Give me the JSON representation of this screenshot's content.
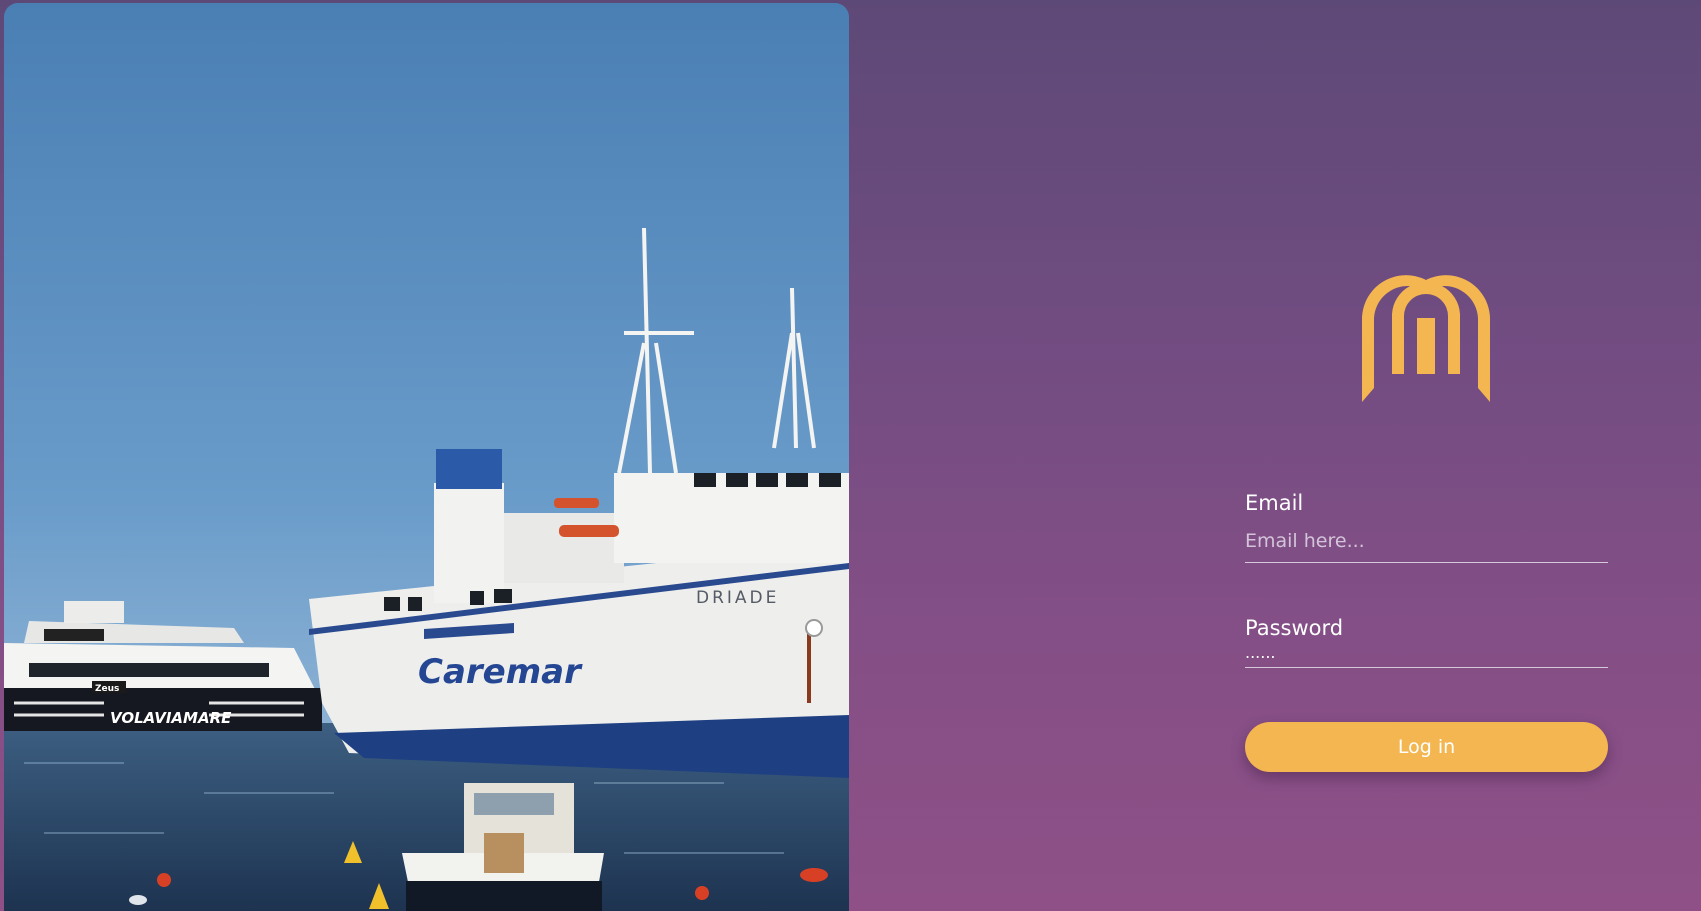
{
  "brand": {
    "logo_icon": "m-arch-logo-icon",
    "accent_color": "#f3b650"
  },
  "hero_image": {
    "icon": "harbor-ferry-photo",
    "hull_lettering": {
      "ferry_brand": "Caremar",
      "ferry_name": "DRIADE",
      "hydrofoil_line": "VOLAVIAMARE",
      "hydrofoil_name": "Zeus"
    }
  },
  "login": {
    "email_label": "Email",
    "email_placeholder": "Email here...",
    "email_value": "",
    "password_label": "Password",
    "password_value": "......",
    "submit_label": "Log in"
  }
}
